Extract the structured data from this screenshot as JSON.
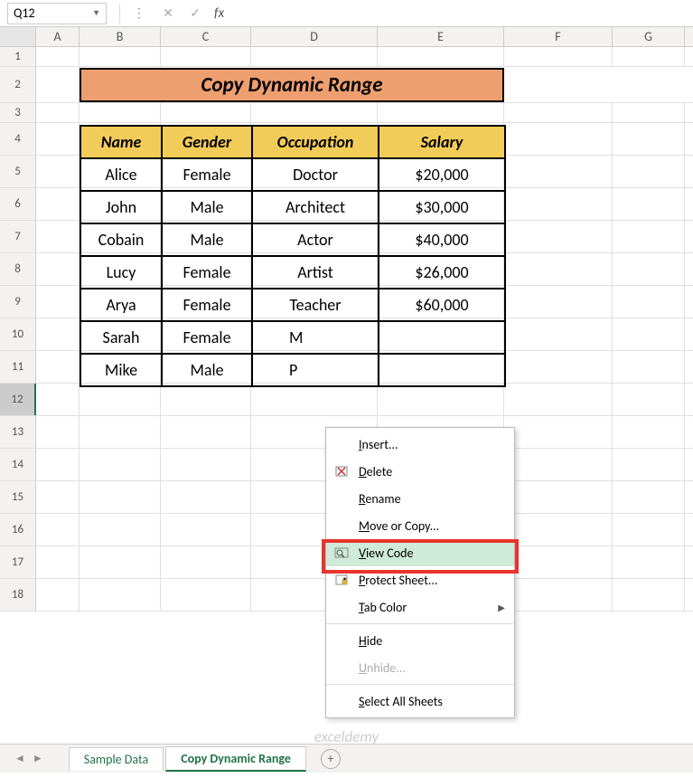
{
  "name_box": "Q12",
  "title": "Copy Dynamic Range",
  "columns": [
    "A",
    "B",
    "C",
    "D",
    "E",
    "F",
    "G"
  ],
  "row_numbers": [
    1,
    2,
    3,
    4,
    5,
    6,
    7,
    8,
    9,
    10,
    11,
    12,
    13,
    14,
    15,
    16,
    17,
    18
  ],
  "selected_row": 12,
  "table": {
    "headers": [
      "Name",
      "Gender",
      "Occupation",
      "Salary"
    ],
    "rows": [
      [
        "Alice",
        "Female",
        "Doctor",
        "$20,000"
      ],
      [
        "John",
        "Male",
        "Architect",
        "$30,000"
      ],
      [
        "Cobain",
        "Male",
        "Actor",
        "$40,000"
      ],
      [
        "Lucy",
        "Female",
        "Artist",
        "$26,000"
      ],
      [
        "Arya",
        "Female",
        "Teacher",
        "$60,000"
      ],
      [
        "Sarah",
        "Female",
        "M",
        ""
      ],
      [
        "Mike",
        "Male",
        "P",
        ""
      ]
    ]
  },
  "context_menu": [
    {
      "label": "Insert...",
      "underline_char": "I",
      "icon": "",
      "has_submenu": false,
      "disabled": false,
      "highlighted": false
    },
    {
      "label": "Delete",
      "underline_char": "D",
      "icon": "delete",
      "has_submenu": false,
      "disabled": false,
      "highlighted": false
    },
    {
      "label": "Rename",
      "underline_char": "R",
      "icon": "",
      "has_submenu": false,
      "disabled": false,
      "highlighted": false
    },
    {
      "label": "Move or Copy...",
      "underline_char": "M",
      "icon": "",
      "has_submenu": false,
      "disabled": false,
      "highlighted": false
    },
    {
      "label": "View Code",
      "underline_char": "V",
      "icon": "viewcode",
      "has_submenu": false,
      "disabled": false,
      "highlighted": true
    },
    {
      "label": "Protect Sheet...",
      "underline_char": "P",
      "icon": "protect",
      "has_submenu": false,
      "disabled": false,
      "highlighted": false
    },
    {
      "label": "Tab Color",
      "underline_char": "T",
      "icon": "",
      "has_submenu": true,
      "disabled": false,
      "highlighted": false
    },
    {
      "label": "Hide",
      "underline_char": "H",
      "icon": "",
      "has_submenu": false,
      "disabled": false,
      "highlighted": false
    },
    {
      "label": "Unhide...",
      "underline_char": "U",
      "icon": "",
      "has_submenu": false,
      "disabled": true,
      "highlighted": false
    },
    {
      "label": "Select All Sheets",
      "underline_char": "S",
      "icon": "",
      "has_submenu": false,
      "disabled": false,
      "highlighted": false
    }
  ],
  "sheet_tabs": [
    {
      "name": "Sample Data",
      "active": false
    },
    {
      "name": "Copy Dynamic Range",
      "active": true
    }
  ],
  "watermark": "exceldemy",
  "fx": "fx"
}
